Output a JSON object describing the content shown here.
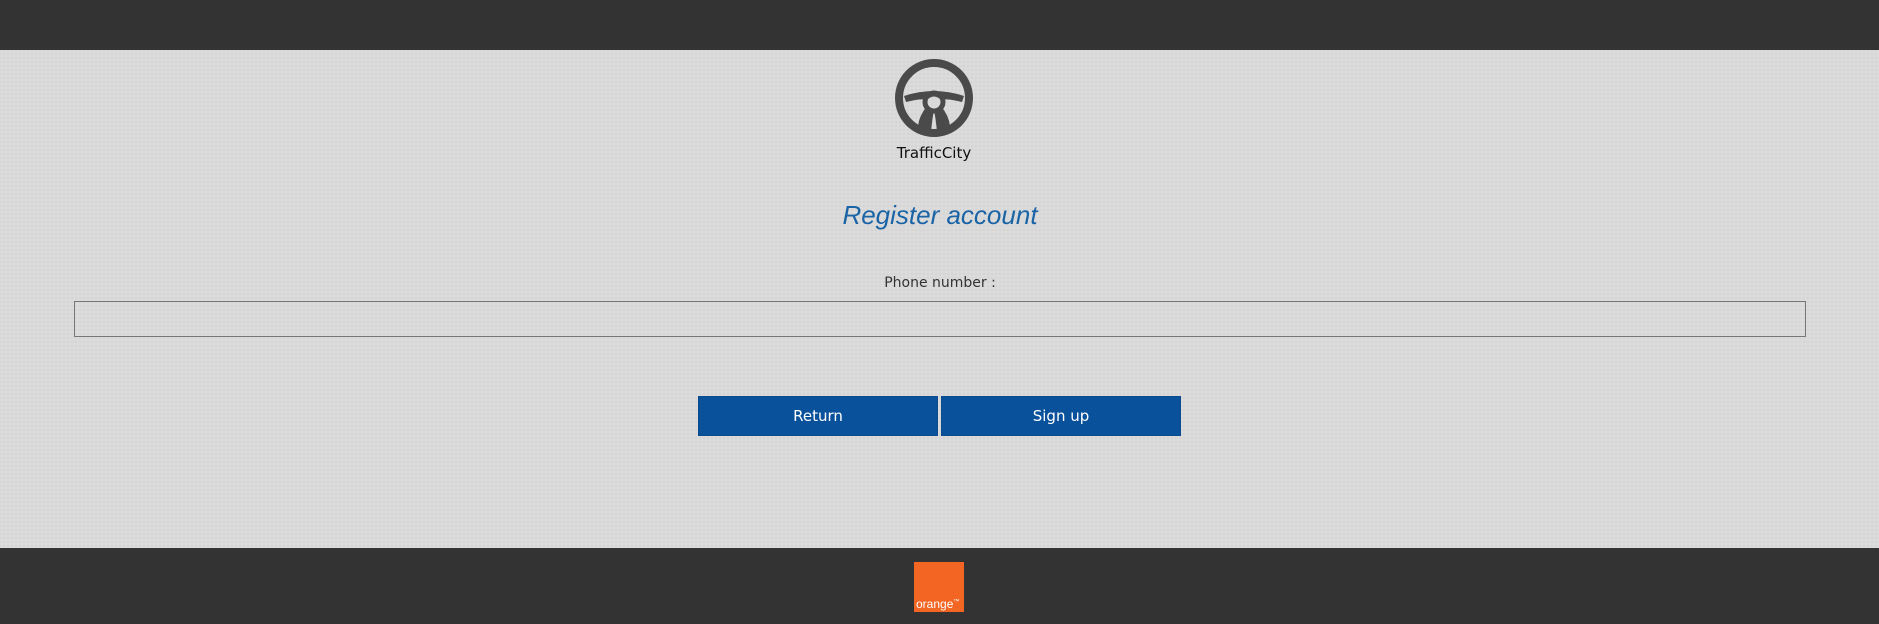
{
  "brand": {
    "name": "TrafficCity",
    "icon": "steering-wheel-icon"
  },
  "form": {
    "title": "Register account",
    "phone_label": "Phone number :",
    "phone_value": "",
    "phone_placeholder": ""
  },
  "buttons": {
    "return_label": "Return",
    "signup_label": "Sign up"
  },
  "footer": {
    "logo_text": "orange",
    "logo_tm": "™"
  },
  "colors": {
    "bars": "#333333",
    "background": "#d9d9d9",
    "title": "#1a64a6",
    "button": "#0a519b",
    "orange": "#f26522"
  }
}
